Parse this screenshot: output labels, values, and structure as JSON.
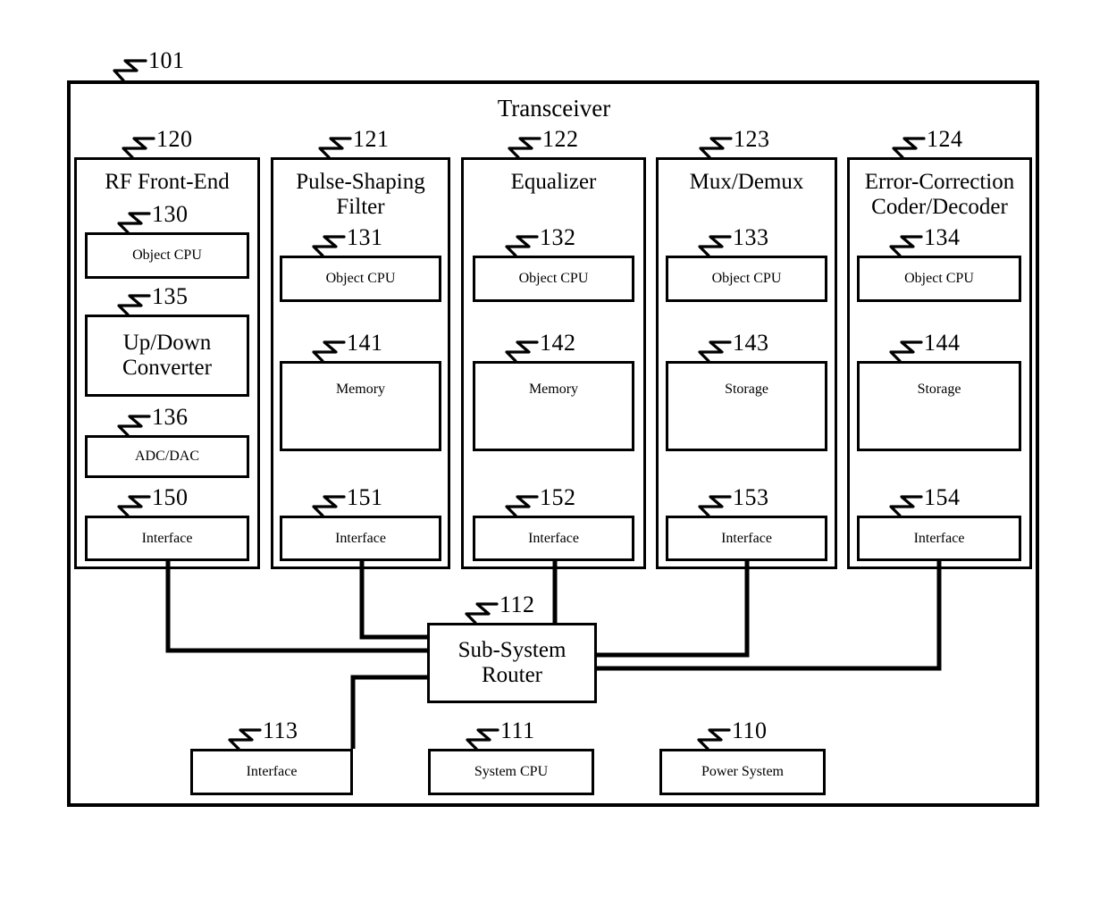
{
  "figure": {
    "frame_label": "Transceiver",
    "frame_ref": "101"
  },
  "columns": [
    {
      "ref": "120",
      "title": "RF Front-End",
      "blocks": [
        {
          "ref": "130",
          "label": "Object CPU"
        },
        {
          "ref": "135",
          "label": "Up/Down Converter"
        },
        {
          "ref": "136",
          "label": "ADC/DAC"
        },
        {
          "ref": "150",
          "label": "Interface"
        }
      ]
    },
    {
      "ref": "121",
      "title": "Pulse-Shaping Filter",
      "blocks": [
        {
          "ref": "131",
          "label": "Object CPU"
        },
        {
          "ref": "141",
          "label": "Memory"
        },
        {
          "ref": "151",
          "label": "Interface"
        }
      ]
    },
    {
      "ref": "122",
      "title": "Equalizer",
      "blocks": [
        {
          "ref": "132",
          "label": "Object CPU"
        },
        {
          "ref": "142",
          "label": "Memory"
        },
        {
          "ref": "152",
          "label": "Interface"
        }
      ]
    },
    {
      "ref": "123",
      "title": "Mux/Demux",
      "blocks": [
        {
          "ref": "133",
          "label": "Object CPU"
        },
        {
          "ref": "143",
          "label": "Storage"
        },
        {
          "ref": "153",
          "label": "Interface"
        }
      ]
    },
    {
      "ref": "124",
      "title": "Error-Correction Coder/Decoder",
      "blocks": [
        {
          "ref": "134",
          "label": "Object CPU"
        },
        {
          "ref": "144",
          "label": "Storage"
        },
        {
          "ref": "154",
          "label": "Interface"
        }
      ]
    }
  ],
  "system": {
    "router": {
      "ref": "112",
      "label": "Sub-System Router"
    },
    "interface": {
      "ref": "113",
      "label": "Interface"
    },
    "system_cpu": {
      "ref": "111",
      "label": "System CPU"
    },
    "power_system": {
      "ref": "110",
      "label": "Power System"
    }
  },
  "style": {
    "line_color": "#000000",
    "background": "#ffffff"
  }
}
